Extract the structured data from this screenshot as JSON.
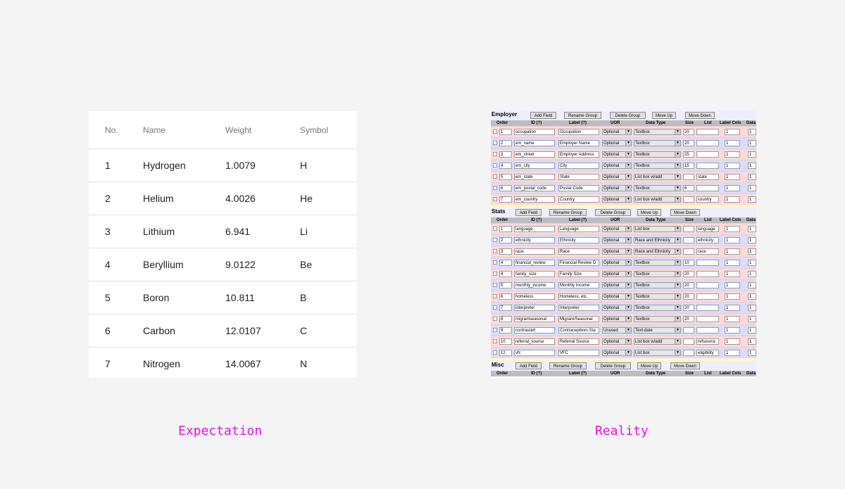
{
  "expectation": {
    "headers": [
      "No.",
      "Name",
      "Weight",
      "Symbol"
    ],
    "rows": [
      [
        "1",
        "Hydrogen",
        "1.0079",
        "H"
      ],
      [
        "2",
        "Helium",
        "4.0026",
        "He"
      ],
      [
        "3",
        "Lithium",
        "6.941",
        "Li"
      ],
      [
        "4",
        "Beryllium",
        "9.0122",
        "Be"
      ],
      [
        "5",
        "Boron",
        "10.811",
        "B"
      ],
      [
        "6",
        "Carbon",
        "12.0107",
        "C"
      ],
      [
        "7",
        "Nitrogen",
        "14.0067",
        "N"
      ]
    ]
  },
  "captions": {
    "left": "Expectation",
    "right": "Reality"
  },
  "reality": {
    "buttons": [
      "Add Field",
      "Rename Group",
      "Delete Group",
      "Move Up",
      "Move Down"
    ],
    "columns": [
      "Order",
      "ID (?)",
      "Label (?)",
      "UOR",
      "Data Type",
      "Size",
      "List",
      "Label Cols",
      "Data"
    ],
    "groups": [
      {
        "name": "Employer",
        "rows": [
          {
            "order": "1",
            "id": "occupation",
            "label": "Occupation",
            "uor": "Optional",
            "type": "Textbox",
            "size": "20",
            "list": "",
            "lcols": "1",
            "data": "1"
          },
          {
            "order": "2",
            "id": "em_name",
            "label": "Employer Name",
            "uor": "Optional",
            "type": "Textbox",
            "size": "20",
            "list": "",
            "lcols": "1",
            "data": "1"
          },
          {
            "order": "3",
            "id": "em_street",
            "label": "Employer Address",
            "uor": "Optional",
            "type": "Textbox",
            "size": "25",
            "list": "",
            "lcols": "1",
            "data": "1"
          },
          {
            "order": "4",
            "id": "em_city",
            "label": "City",
            "uor": "Optional",
            "type": "Textbox",
            "size": "15",
            "list": "",
            "lcols": "1",
            "data": "1"
          },
          {
            "order": "5",
            "id": "em_state",
            "label": "State",
            "uor": "Optional",
            "type": "List box w/add",
            "size": "",
            "list": "state",
            "lcols": "1",
            "data": "1"
          },
          {
            "order": "6",
            "id": "em_postal_code",
            "label": "Postal Code",
            "uor": "Optional",
            "type": "Textbox",
            "size": "6",
            "list": "",
            "lcols": "1",
            "data": "1"
          },
          {
            "order": "7",
            "id": "em_country",
            "label": "Country",
            "uor": "Optional",
            "type": "List box w/add",
            "size": "",
            "list": "country",
            "lcols": "1",
            "data": "1"
          }
        ]
      },
      {
        "name": "Stats",
        "rows": [
          {
            "order": "1",
            "id": "language",
            "label": "Language",
            "uor": "Optional",
            "type": "List box",
            "size": "",
            "list": "language",
            "lcols": "1",
            "data": "1"
          },
          {
            "order": "2",
            "id": "ethnicity",
            "label": "Ethnicity",
            "uor": "Optional",
            "type": "Race and Ethnicity",
            "size": "",
            "list": "ethnicity",
            "lcols": "1",
            "data": "1"
          },
          {
            "order": "3",
            "id": "race",
            "label": "Race",
            "uor": "Optional",
            "type": "Race and Ethnicity",
            "size": "",
            "list": "race",
            "lcols": "1",
            "data": "1"
          },
          {
            "order": "4",
            "id": "financial_review",
            "label": "Financial Review D",
            "uor": "Optional",
            "type": "Textbox",
            "size": "10",
            "list": "",
            "lcols": "1",
            "data": "1"
          },
          {
            "order": "4",
            "id": "family_size",
            "label": "Family Size",
            "uor": "Optional",
            "type": "Textbox",
            "size": "20",
            "list": "",
            "lcols": "1",
            "data": "1"
          },
          {
            "order": "5",
            "id": "monthly_income",
            "label": "Monthly Income",
            "uor": "Optional",
            "type": "Textbox",
            "size": "20",
            "list": "",
            "lcols": "1",
            "data": "1"
          },
          {
            "order": "6",
            "id": "homeless",
            "label": "Homeless, etc.",
            "uor": "Optional",
            "type": "Textbox",
            "size": "20",
            "list": "",
            "lcols": "1",
            "data": "1"
          },
          {
            "order": "7",
            "id": "interpreter",
            "label": "Interpreter",
            "uor": "Optional",
            "type": "Textbox",
            "size": "20",
            "list": "",
            "lcols": "1",
            "data": "1"
          },
          {
            "order": "8",
            "id": "migrantseasonal",
            "label": "Migrant/Seasonal",
            "uor": "Optional",
            "type": "Textbox",
            "size": "20",
            "list": "",
            "lcols": "1",
            "data": "1"
          },
          {
            "order": "9",
            "id": "contrastart",
            "label": "Contraceptives Sta",
            "uor": "Unused",
            "type": "Text-date",
            "size": "",
            "list": "",
            "lcols": "1",
            "data": "1"
          },
          {
            "order": "10",
            "id": "referral_source",
            "label": "Referral Source",
            "uor": "Optional",
            "type": "List box w/add",
            "size": "",
            "list": "refsource",
            "lcols": "1",
            "data": "1"
          },
          {
            "order": "12",
            "id": "vfc",
            "label": "VFC",
            "uor": "Optional",
            "type": "List box",
            "size": "",
            "list": "eligibility",
            "lcols": "1",
            "data": "1"
          }
        ]
      },
      {
        "name": "Misc",
        "rows": []
      }
    ]
  }
}
